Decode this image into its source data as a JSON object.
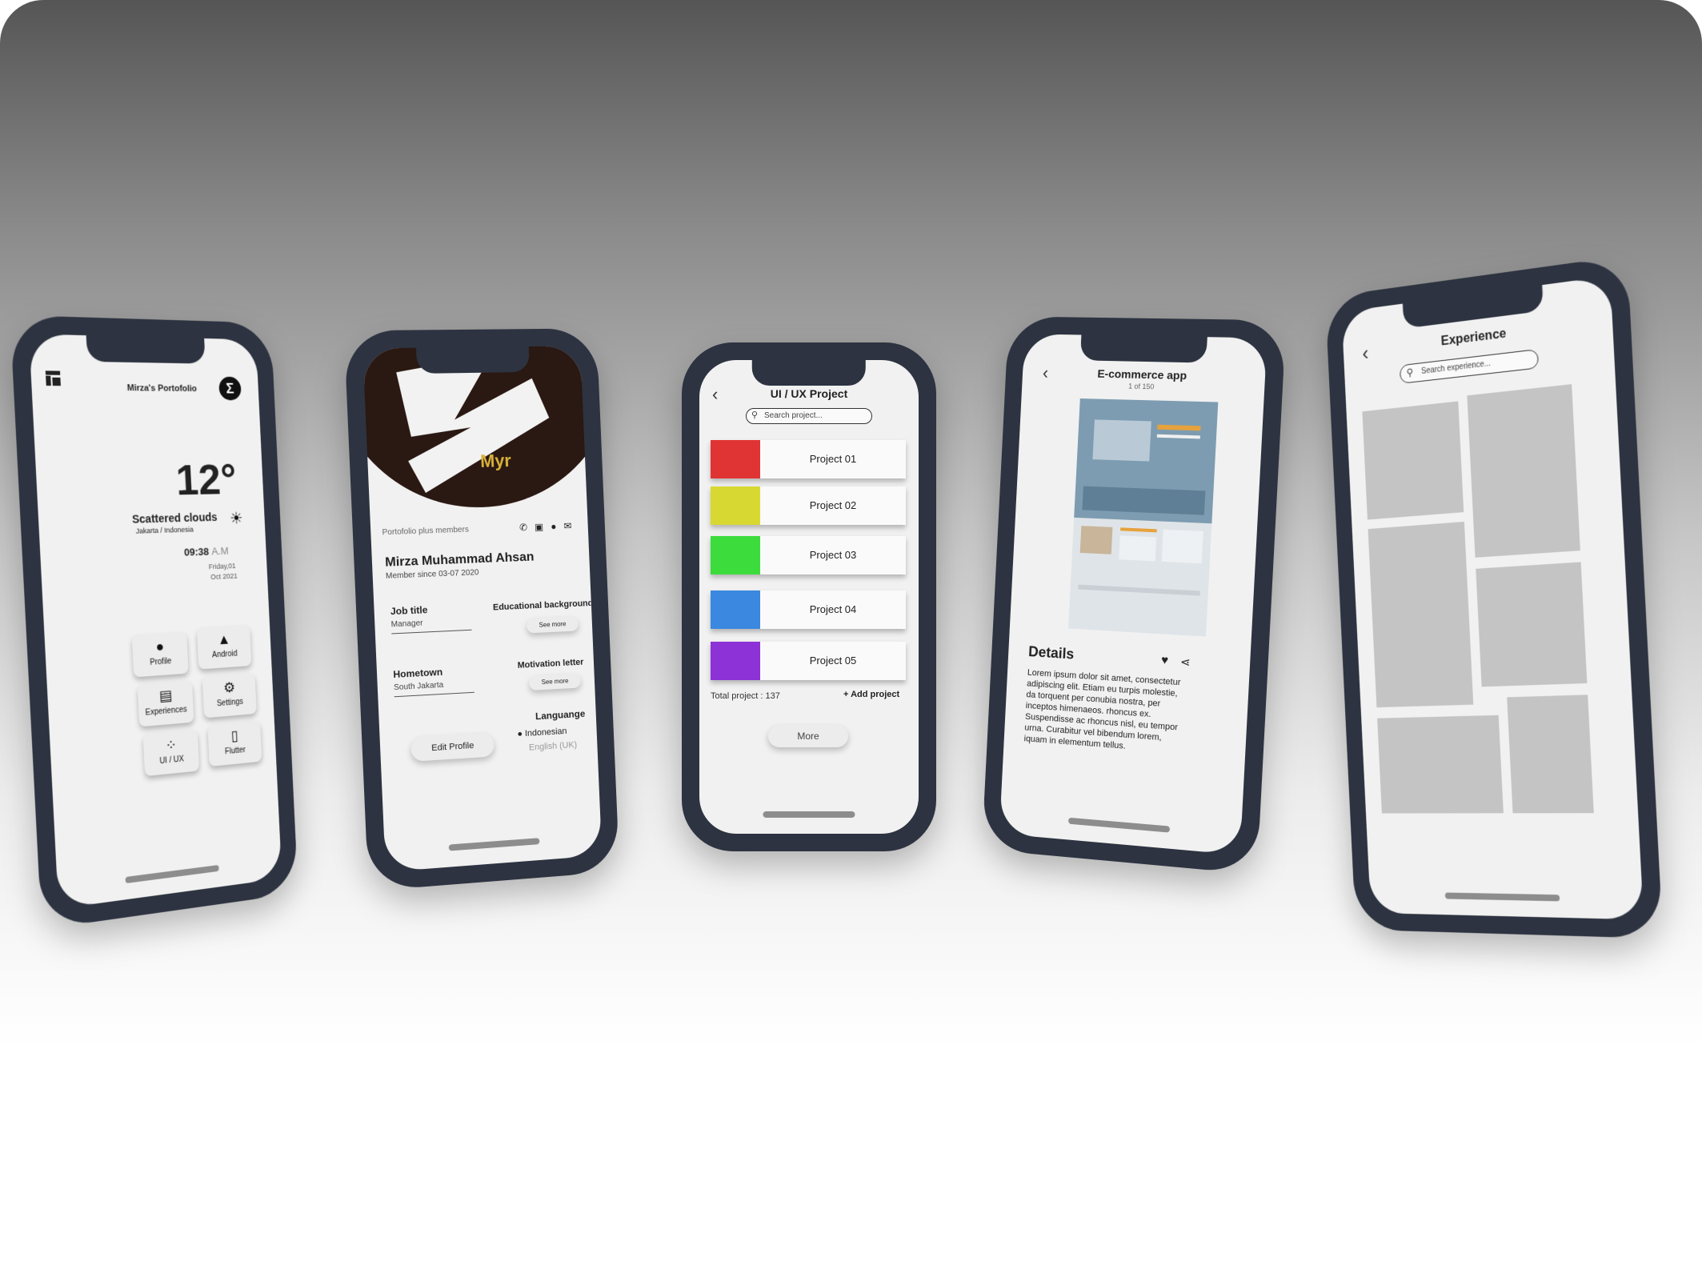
{
  "colors": {
    "phone_frame": "#2d3340",
    "screen_bg": "#f1f1f1",
    "project_swatches": [
      "#e03434",
      "#d8d832",
      "#3cdc3c",
      "#3a88e0",
      "#8c32d6"
    ]
  },
  "phone1": {
    "brand_title": "Mirza's Portofolio",
    "logo_letter": "Σ",
    "temperature": "12°",
    "weather": "Scattered clouds",
    "location": "Jakarta / Indonesia",
    "time": "09:38",
    "ampm": "A.M",
    "date_line1": "Friday,01",
    "date_line2": "Oct 2021",
    "tiles": [
      {
        "label": "Profile",
        "icon": "person-icon"
      },
      {
        "label": "Android",
        "icon": "android-icon"
      },
      {
        "label": "Experiences",
        "icon": "book-icon"
      },
      {
        "label": "Settings",
        "icon": "settings-icon"
      },
      {
        "label": "UI / UX",
        "icon": "figma-icon"
      },
      {
        "label": "Flutter",
        "icon": "file-icon"
      }
    ]
  },
  "phone2": {
    "banner_text": "Myr",
    "section_label": "Portofolio plus members",
    "name": "Mirza Muhammad Ahsan",
    "member_since": "Member since 03-07 2020",
    "job_title_label": "Job title",
    "job_title_value": "Manager",
    "edu_label": "Educational background",
    "see_more": "See more",
    "hometown_label": "Hometown",
    "hometown_value": "South Jakarta",
    "motivation_label": "Motivation letter",
    "language_label": "Languange",
    "language_selected": "Indonesian",
    "language_other": "English (UK)",
    "edit_profile": "Edit Profile"
  },
  "phone3": {
    "title": "UI / UX Project",
    "search_placeholder": "Search project...",
    "projects": [
      "Project 01",
      "Project 02",
      "Project 03",
      "Project 04",
      "Project 05"
    ],
    "total": "Total project : 137",
    "add": "+ Add project",
    "more": "More"
  },
  "phone4": {
    "title": "E-commerce app",
    "counter": "1 of 150",
    "details_title": "Details",
    "details_text": "Lorem ipsum dolor sit amet, consectetur adipiscing elit. Etiam eu turpis molestie, da torquent per conubia nostra, per inceptos himenaeos. rhoncus ex. Suspendisse ac rhoncus nisl, eu tempor urna. Curabitur vel bibendum lorem, iquam in elementum tellus."
  },
  "phone5": {
    "title": "Experience",
    "search_placeholder": "Search experience..."
  }
}
